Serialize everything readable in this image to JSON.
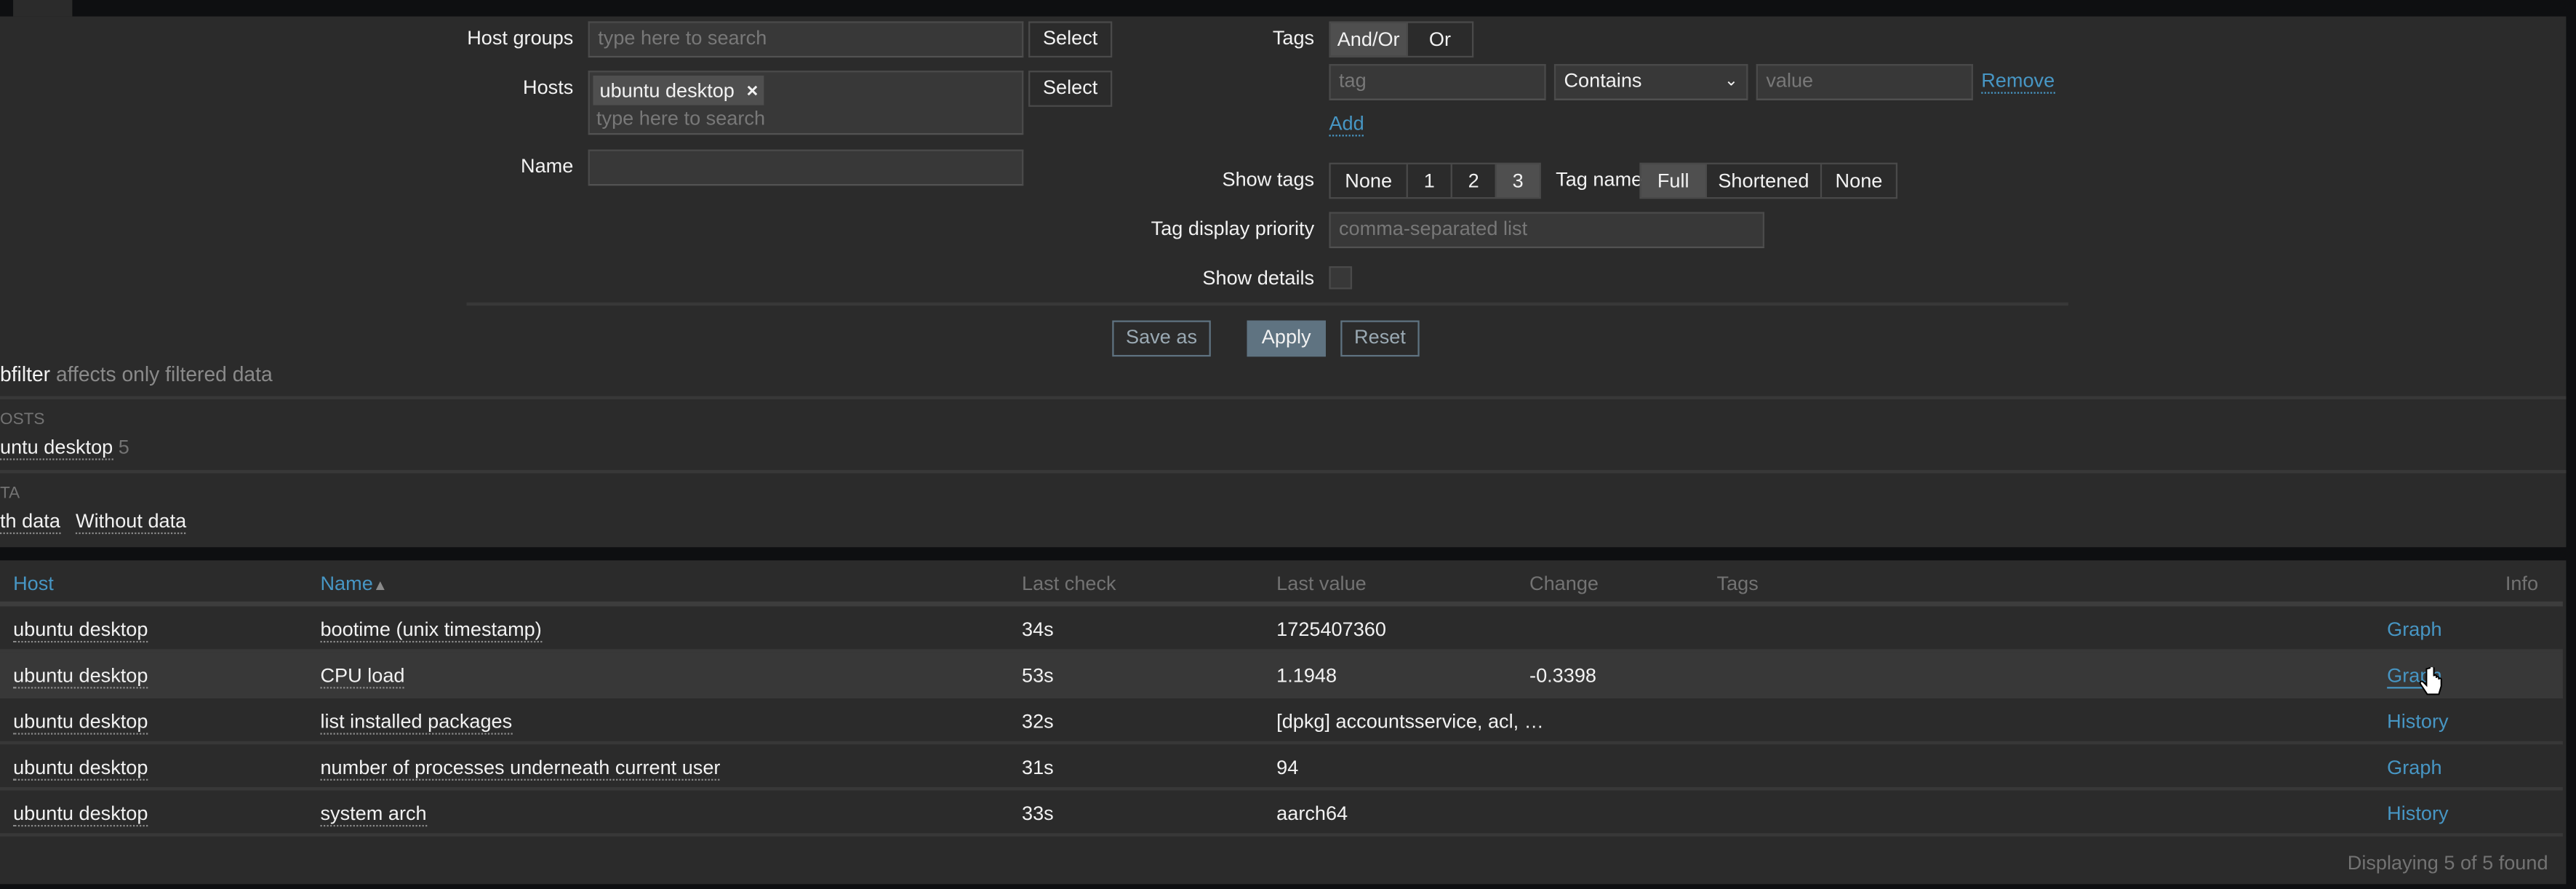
{
  "filter": {
    "host_groups": {
      "label": "Host groups",
      "placeholder": "type here to search",
      "select_label": "Select"
    },
    "hosts": {
      "label": "Hosts",
      "chips": [
        "ubuntu desktop"
      ],
      "remove_icon": "×",
      "placeholder": "type here to search",
      "select_label": "Select"
    },
    "name": {
      "label": "Name",
      "value": ""
    },
    "tags": {
      "label": "Tags",
      "mode_options": [
        "And/Or",
        "Or"
      ],
      "mode_selected": "And/Or",
      "tag_placeholder": "tag",
      "operator": "Contains",
      "value_placeholder": "value",
      "remove_label": "Remove",
      "add_label": "Add"
    },
    "show_tags": {
      "label": "Show tags",
      "options": [
        "None",
        "1",
        "2",
        "3"
      ],
      "selected": "3"
    },
    "tag_name": {
      "label": "Tag name",
      "options": [
        "Full",
        "Shortened",
        "None"
      ],
      "selected": "Full"
    },
    "tag_display_priority": {
      "label": "Tag display priority",
      "placeholder": "comma-separated list"
    },
    "show_details": {
      "label": "Show details",
      "checked": false
    },
    "buttons": {
      "save_as": "Save as",
      "apply": "Apply",
      "reset": "Reset"
    }
  },
  "subfilter": {
    "title": "bfilter",
    "note": "affects only filtered data",
    "hosts_heading": "OSTS",
    "hosts": [
      {
        "label": "untu desktop",
        "count": "5"
      }
    ],
    "data_heading": "TA",
    "data_options": [
      "th data",
      "Without data"
    ]
  },
  "table": {
    "columns": [
      "Host",
      "Name",
      "Last check",
      "Last value",
      "Change",
      "Tags",
      "Info"
    ],
    "sort_indicator": "▲",
    "rows": [
      {
        "host": "ubuntu desktop",
        "name": "bootime (unix timestamp)",
        "last_check": "34s",
        "last_value": "1725407360",
        "change": "",
        "action": "Graph"
      },
      {
        "host": "ubuntu desktop",
        "name": "CPU load",
        "last_check": "53s",
        "last_value": "1.1948",
        "change": "-0.3398",
        "action": "Graph"
      },
      {
        "host": "ubuntu desktop",
        "name": "list installed packages",
        "last_check": "32s",
        "last_value": "[dpkg] accountsservice, acl, …",
        "change": "",
        "action": "History"
      },
      {
        "host": "ubuntu desktop",
        "name": "number of processes underneath current user",
        "last_check": "31s",
        "last_value": "94",
        "change": "",
        "action": "Graph"
      },
      {
        "host": "ubuntu desktop",
        "name": "system arch",
        "last_check": "33s",
        "last_value": "aarch64",
        "change": "",
        "action": "History"
      }
    ],
    "footer": "Displaying 5 of 5 found"
  },
  "colors": {
    "link": "#4796c4",
    "background": "#2b2b2b",
    "apply_button": "#5f7381"
  }
}
